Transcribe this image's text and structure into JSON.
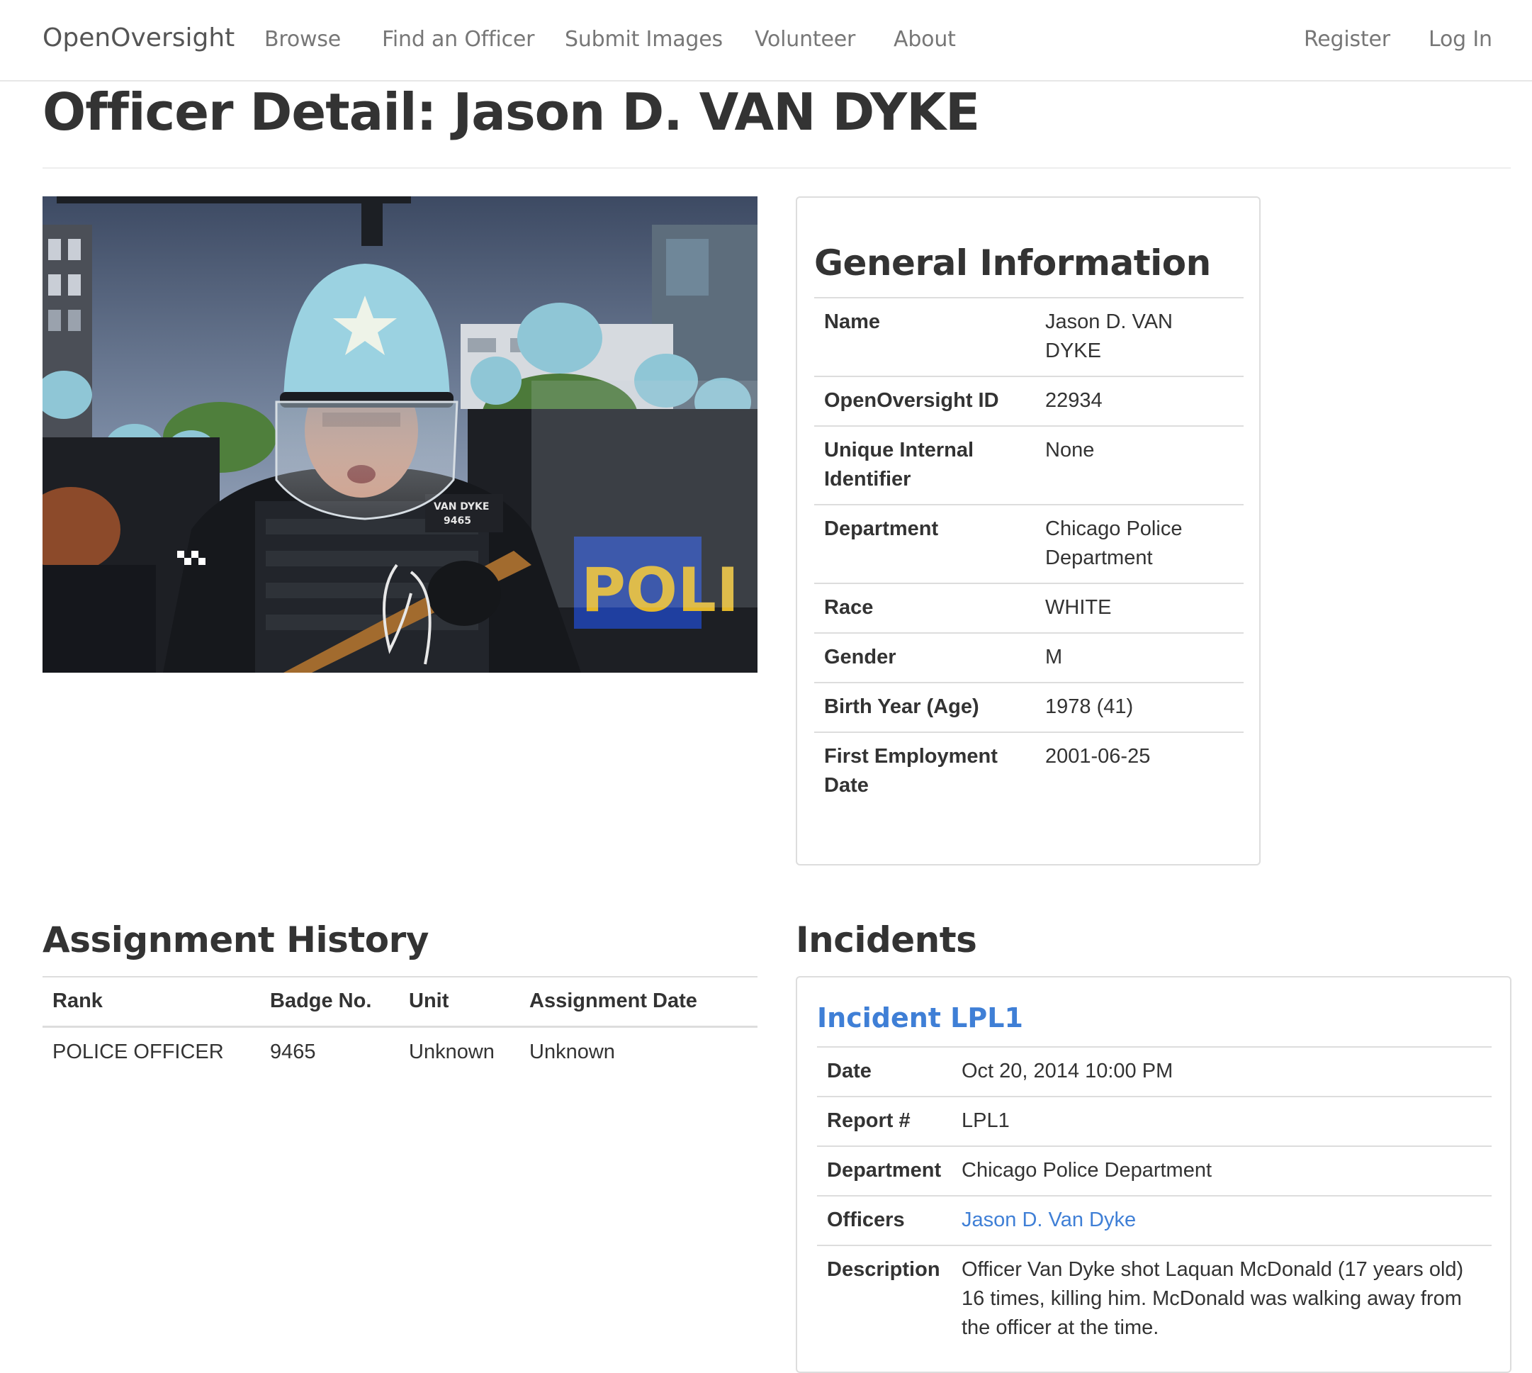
{
  "navbar": {
    "brand": "OpenOversight",
    "links": [
      "Browse",
      "Find an Officer",
      "Submit Images",
      "Volunteer",
      "About"
    ],
    "register": "Register",
    "login": "Log In"
  },
  "page_title": "Officer Detail: Jason D. VAN DYKE",
  "photo": {
    "nameplate_line1": "VAN DYKE",
    "nameplate_line2": "9465",
    "shield_text": "POLI"
  },
  "general_info": {
    "heading": "General Information",
    "rows": [
      {
        "label": "Name",
        "value": "Jason D. VAN DYKE"
      },
      {
        "label": "OpenOversight ID",
        "value": "22934"
      },
      {
        "label": "Unique Internal Identifier",
        "value": "None"
      },
      {
        "label": "Department",
        "value": "Chicago Police Department"
      },
      {
        "label": "Race",
        "value": "WHITE"
      },
      {
        "label": "Gender",
        "value": "M"
      },
      {
        "label": "Birth Year (Age)",
        "value": "1978 (41)"
      },
      {
        "label": "First Employment Date",
        "value": "2001-06-25"
      }
    ]
  },
  "assignment_history": {
    "heading": "Assignment History",
    "columns": [
      "Rank",
      "Badge No.",
      "Unit",
      "Assignment Date"
    ],
    "rows": [
      [
        "POLICE OFFICER",
        "9465",
        "Unknown",
        "Unknown"
      ]
    ]
  },
  "incidents": {
    "heading": "Incidents",
    "items": [
      {
        "title": "Incident LPL1",
        "date_label": "Date",
        "date": "Oct 20, 2014 10:00 PM",
        "report_label": "Report #",
        "report": "LPL1",
        "department_label": "Department",
        "department": "Chicago Police Department",
        "officers_label": "Officers",
        "officers": "Jason D. Van Dyke",
        "description_label": "Description",
        "description": "Officer Van Dyke shot Laquan McDonald (17 years old) 16 times, killing him. McDonald was walking away from the officer at the time."
      }
    ]
  }
}
